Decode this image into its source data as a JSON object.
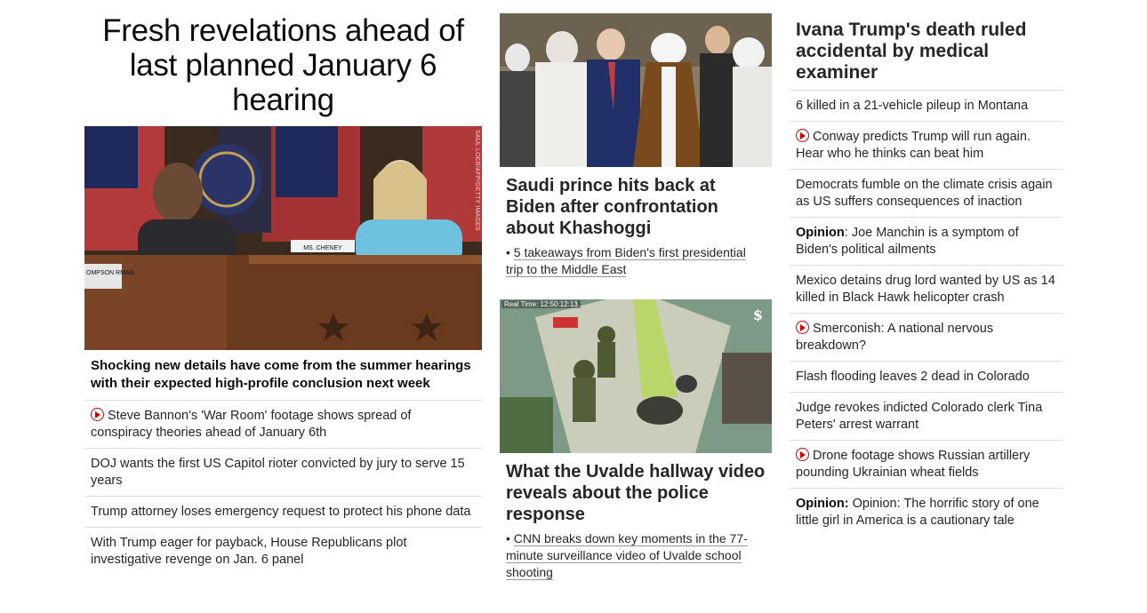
{
  "left": {
    "headline": "Fresh revelations ahead of last planned January 6 hearing",
    "image_credit": "SAUL LOEB/AFP/GETTY IMAGES",
    "image_name_plate": "MS. CHENEY",
    "image_chair_plate": "OMPSON RMAN",
    "subheadline": "Shocking new details have come from the summer hearings with their expected high-profile conclusion next week",
    "items": [
      {
        "text": "Steve Bannon's 'War Room' footage shows spread of conspiracy theories ahead of January 6th",
        "video": true
      },
      {
        "text": "DOJ wants the first US Capitol rioter convicted by jury to serve 15 years",
        "video": false
      },
      {
        "text": "Trump attorney loses emergency request to protect his phone data",
        "video": false
      },
      {
        "text": "With Trump eager for payback, House Republicans plot investigative revenge on Jan. 6 panel",
        "video": false
      }
    ]
  },
  "middle": {
    "story1": {
      "title": "Saudi prince hits back at Biden after confrontation about Khashoggi",
      "link": "5 takeaways from Biden's first presidential trip to the Middle East"
    },
    "story2": {
      "image_timestamp": "Real Time: 12:50:12:13",
      "image_logo": "$",
      "title": "What the Uvalde hallway video reveals about the police response",
      "link": "CNN breaks down key moments in the 77-minute surveillance video of Uvalde school shooting"
    },
    "bullet": "•"
  },
  "right": {
    "headline": "Ivana Trump's death ruled accidental by medical examiner",
    "items": [
      {
        "text": "6 killed in a 21-vehicle pileup in Montana"
      },
      {
        "text": "Conway predicts Trump will run again. Hear who he thinks can beat him",
        "video": true
      },
      {
        "text": "Democrats fumble on the climate crisis again as US suffers consequences of inaction"
      },
      {
        "label": "Opinion",
        "text": ": Joe Manchin is a symptom of Biden's political ailments"
      },
      {
        "text": "Mexico detains drug lord wanted by US as 14 killed in Black Hawk helicopter crash"
      },
      {
        "text": "Smerconish: A national nervous breakdown?",
        "video": true
      },
      {
        "text": "Flash flooding leaves 2 dead in Colorado"
      },
      {
        "text": "Judge revokes indicted Colorado clerk Tina Peters' arrest warrant"
      },
      {
        "text": "Drone footage shows Russian artillery pounding Ukrainian wheat fields",
        "video": true
      },
      {
        "label": "Opinion:",
        "text": " Opinion: The horrific story of one little girl in America is a cautionary tale"
      }
    ]
  },
  "colors": {
    "accent": "#cc0000",
    "divider": "#dddddd",
    "text": "#262626"
  }
}
